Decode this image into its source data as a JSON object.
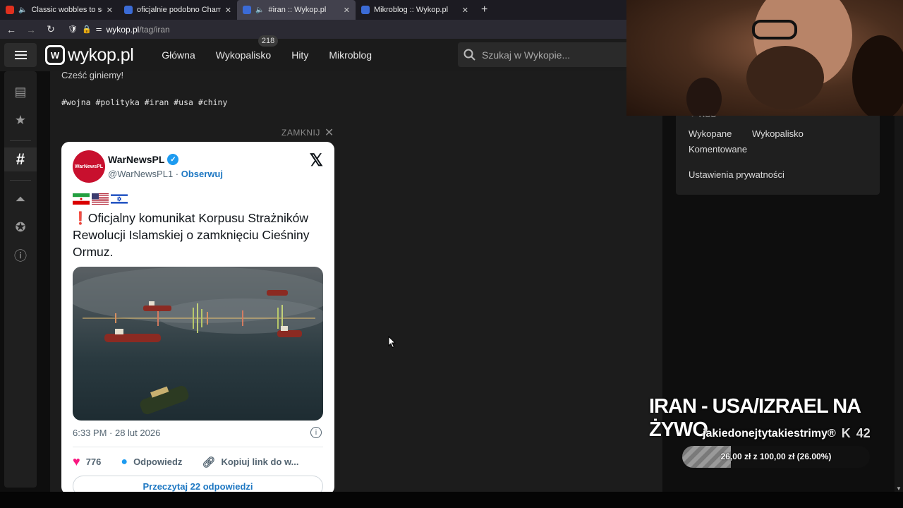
{
  "browser": {
    "tabs": [
      {
        "title": "Classic wobbles to soothe y",
        "fav_color": "#e0301e",
        "audio": true,
        "active": false
      },
      {
        "title": "oficjalnie podobno Chamenei R",
        "fav_color": "#3b6bd6",
        "audio": false,
        "active": false
      },
      {
        "title": "#iran :: Wykop.pl",
        "fav_color": "#3b6bd6",
        "audio": true,
        "active": true
      },
      {
        "title": "Mikroblog :: Wykop.pl",
        "fav_color": "#3b6bd6",
        "audio": false,
        "active": false
      }
    ],
    "url_host": "wykop.pl",
    "url_path": "/tag/iran"
  },
  "header": {
    "logo": "wykop.pl",
    "nav": [
      "Główna",
      "Wykopalisko",
      "Hity",
      "Mikroblog"
    ],
    "wykopalisko_badge": "218",
    "search_placeholder": "Szukaj w Wykopie..."
  },
  "post": {
    "text": "Cześć giniemy!",
    "tags": "#wojna #polityka #iran #usa #chiny",
    "close_label": "ZAMKNIJ"
  },
  "tweet": {
    "avatar_text": "WarNewsPL",
    "name": "WarNewsPL",
    "handle": "@WarNewsPL1",
    "follow": "Obserwuj",
    "body": "❗Oficjalny komunikat Korpusu Strażników Rewolucji Islamskiej o zamknięciu Cieśniny Ormuz.",
    "time": "6:33 PM · 28 lut 2026",
    "likes": "776",
    "reply_label": "Odpowiedz",
    "copy_label": "Kopiuj link do w...",
    "replies_label": "Przeczytaj 22 odpowiedzi"
  },
  "right": {
    "rss": "RSS",
    "links": [
      "Wykopane",
      "Wykopalisko",
      "Komentowane",
      "Ustawienia prywatności"
    ]
  },
  "overlay": {
    "title": "IRAN - USA/IZRAEL NA ŻYWO",
    "channel": "jakiedonejtytakiestrimy®",
    "k_count": "42",
    "goal_text": "26,00 zł z 100,00 zł (26.00%)",
    "goal_fraction": 0.26
  }
}
